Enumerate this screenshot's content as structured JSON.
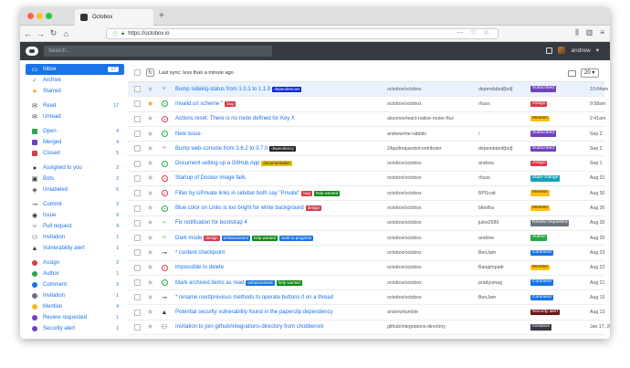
{
  "browser": {
    "tab_title": "Octobox",
    "url": "https://octobox.io",
    "new_tab": "+"
  },
  "app": {
    "search_placeholder": "Search...",
    "user": "andrew"
  },
  "sidebar": [
    {
      "label": "Inbox",
      "count": "17",
      "icon": "inbox-icon",
      "active": true
    },
    {
      "label": "Archive",
      "count": "",
      "icon": "check-icon",
      "color": "#2ea44f"
    },
    {
      "label": "Starred",
      "count": "",
      "icon": "star-icon",
      "color": "#f0a020"
    },
    {
      "sep": true
    },
    {
      "label": "Read",
      "count": "17",
      "icon": "read-icon"
    },
    {
      "label": "Unread",
      "count": "",
      "icon": "unread-icon"
    },
    {
      "sep": true
    },
    {
      "label": "Open",
      "count": "4",
      "icon": "square-icon",
      "color": "#2ea44f"
    },
    {
      "label": "Merged",
      "count": "4",
      "icon": "square-icon",
      "color": "#6f42c1"
    },
    {
      "label": "Closed",
      "count": "5",
      "icon": "square-icon",
      "color": "#d73a49"
    },
    {
      "sep": true
    },
    {
      "label": "Assigned to you",
      "count": "2",
      "icon": "person-icon"
    },
    {
      "label": "Bots",
      "count": "2",
      "icon": "bot-icon"
    },
    {
      "label": "Unlabeled",
      "count": "6",
      "icon": "tag-icon"
    },
    {
      "sep": true
    },
    {
      "label": "Commit",
      "count": "2",
      "icon": "commit-icon"
    },
    {
      "label": "Issue",
      "count": "9",
      "icon": "issue-icon"
    },
    {
      "label": "Pull request",
      "count": "4",
      "icon": "pull-request-icon"
    },
    {
      "label": "Invitation",
      "count": "1",
      "icon": "invitation-icon"
    },
    {
      "label": "Vulnerability alert",
      "count": "1",
      "icon": "alert-icon"
    },
    {
      "sep": true
    },
    {
      "label": "Assign",
      "count": "2",
      "icon": "dot-icon",
      "color": "#d73a49"
    },
    {
      "label": "Author",
      "count": "1",
      "icon": "dot-icon",
      "color": "#2ea44f"
    },
    {
      "label": "Comment",
      "count": "3",
      "icon": "dot-icon",
      "color": "#1a73e8"
    },
    {
      "label": "Invitation",
      "count": "1",
      "icon": "dot-icon",
      "color": "#6c757d"
    },
    {
      "label": "Mention",
      "count": "4",
      "icon": "dot-icon",
      "color": "#f0c020"
    },
    {
      "label": "Review requested",
      "count": "1",
      "icon": "dot-icon",
      "color": "#6f42c1"
    },
    {
      "label": "Security alert",
      "count": "1",
      "icon": "dot-icon",
      "color": "#6f42c1"
    }
  ],
  "toolbar": {
    "sync_text": "Last sync: less than a minute ago",
    "per_page": "20"
  },
  "reason_colors": {
    "Subscribed": "#6f42c1",
    "Assign": "#d73a49",
    "Mention": "#ffc107",
    "State change": "#17a2b8",
    "Review requested": "#6c757d",
    "Author": "#28a745",
    "Comment": "#1a73e8",
    "Security alert": "#6c1616",
    "Invitation": "#343a40"
  },
  "notifications": [
    {
      "title": "Bump sidekiq-status from 1.0.1 to 1.1.0",
      "labels": [
        {
          "t": "dependencies",
          "c": "#0b28d6"
        }
      ],
      "repo": "octobox/octobox",
      "user": "dependabot[bot]",
      "reason": "Subscribed",
      "time": "10:04am",
      "star": false,
      "icon": "pull-request-icon",
      "color": "#6f42c1",
      "highlight": true
    },
    {
      "title": "Invalid uri scheme '' ",
      "labels": [
        {
          "t": "bug",
          "c": "#d73a49"
        }
      ],
      "repo": "octobox/octobox",
      "user": "rhuss",
      "reason": "Assign",
      "time": "9:58am",
      "star": true,
      "icon": "issue-icon",
      "color": "#28a745"
    },
    {
      "title": "Actions.reset: There is no route defined for Key X",
      "labels": [],
      "repo": "aksonov/react-native-router-flux",
      "user": "",
      "reason": "Mention",
      "time": "2:41am",
      "star": false,
      "icon": "issue-icon",
      "color": "#d73a49"
    },
    {
      "title": "New issue",
      "labels": [],
      "repo": "andrew/me-rabbits",
      "user": "/",
      "reason": "Subscribed",
      "time": "Sep 2",
      "star": false,
      "icon": "issue-icon",
      "color": "#28a745"
    },
    {
      "title": "Bump web-console from 3.6.2 to 3.7.0",
      "labels": [
        {
          "t": "dependency",
          "c": "#222"
        }
      ],
      "repo": "24pullrequests/contributer",
      "user": "dependabot[bot]",
      "reason": "Subscribed",
      "time": "Sep 2",
      "star": false,
      "icon": "pull-request-icon",
      "color": "#6f42c1"
    },
    {
      "title": "Document setting up a GitHub App",
      "labels": [
        {
          "t": "documentation",
          "c": "#e6c300"
        }
      ],
      "repo": "octobox/octobox",
      "user": "andrew",
      "reason": "Assign",
      "time": "Sep 1",
      "star": false,
      "icon": "issue-icon",
      "color": "#28a745"
    },
    {
      "title": "Startup of Docker image fails",
      "labels": [],
      "repo": "octobox/octobox",
      "user": "rhuss",
      "reason": "State change",
      "time": "Aug 31",
      "star": false,
      "icon": "issue-icon",
      "color": "#d73a49"
    },
    {
      "title": "Filter by isPrivate links in sidebar both say \"Private\"",
      "labels": [
        {
          "t": "bug",
          "c": "#d73a49"
        },
        {
          "t": "help wanted",
          "c": "#0e8a16"
        }
      ],
      "repo": "octobox/octobox",
      "user": "BPScott",
      "reason": "Mention",
      "time": "Aug 30",
      "star": false,
      "icon": "issue-icon",
      "color": "#d73a49"
    },
    {
      "title": "Blue color on Links is too bright for white background",
      "labels": [
        {
          "t": "design",
          "c": "#d73a49"
        }
      ],
      "repo": "octobox/octobox",
      "user": "bibotha",
      "reason": "Mention",
      "time": "Aug 30",
      "star": false,
      "icon": "issue-icon",
      "color": "#28a745"
    },
    {
      "title": "Fix notification for bootstrap 4",
      "labels": [],
      "repo": "octobox/octobox",
      "user": "jules2689",
      "reason": "Review requested",
      "time": "Aug 30",
      "star": false,
      "icon": "pull-request-icon",
      "color": "#28a745"
    },
    {
      "title": "Dark mode",
      "labels": [
        {
          "t": "design",
          "c": "#d73a49"
        },
        {
          "t": "enhancement",
          "c": "#1d76db"
        },
        {
          "t": "help wanted",
          "c": "#0e8a16"
        },
        {
          "t": "work in progress",
          "c": "#1a73e8"
        }
      ],
      "repo": "octobox/octobox",
      "user": "andrew",
      "reason": "Author",
      "time": "Aug 30",
      "star": false,
      "icon": "pull-request-icon",
      "color": "#28a745"
    },
    {
      "title": "* content checkpoint",
      "labels": [],
      "repo": "octobox/octobox",
      "user": "BenJam",
      "reason": "Comment",
      "time": "Aug 23",
      "star": false,
      "icon": "commit-icon",
      "color": "#333"
    },
    {
      "title": "impossible to delete",
      "labels": [],
      "repo": "octobox/octobox",
      "user": "Bangimpadr",
      "reason": "Mention",
      "time": "Aug 22",
      "star": false,
      "icon": "issue-icon",
      "color": "#d73a49"
    },
    {
      "title": "Mark archived items as read",
      "labels": [
        {
          "t": "enhancement",
          "c": "#1d76db"
        },
        {
          "t": "help wanted",
          "c": "#0e8a16"
        }
      ],
      "repo": "octobox/octobox",
      "user": "pradyumag",
      "reason": "Comment",
      "time": "Aug 21",
      "star": false,
      "icon": "issue-icon",
      "color": "#28a745"
    },
    {
      "title": "* rename next/previous methods to operate buttons if on a thread",
      "labels": [],
      "repo": "octobox/octobox",
      "user": "BenJam",
      "reason": "Comment",
      "time": "Aug 15",
      "star": false,
      "icon": "commit-icon",
      "color": "#333"
    },
    {
      "title": "Potential security vulnerability found in the paperclip dependency",
      "labels": [],
      "repo": "andrew/tumble",
      "user": "",
      "reason": "Security alert",
      "time": "Aug 13",
      "star": false,
      "icon": "alert-icon",
      "color": "#333"
    },
    {
      "title": "Invitation to join github/integrations-directory from chobberoni",
      "labels": [],
      "repo": "github/integrations-directory",
      "user": "",
      "reason": "Invitation",
      "time": "Jan 17, 2017",
      "star": false,
      "icon": "invitation-icon",
      "color": "#333"
    }
  ]
}
